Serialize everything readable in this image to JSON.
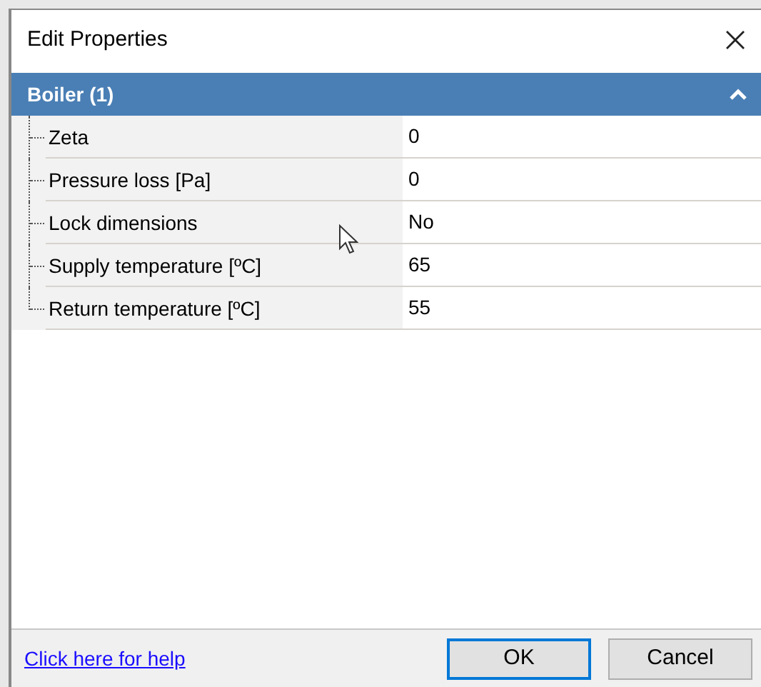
{
  "window": {
    "title": "Edit Properties"
  },
  "category": {
    "label": "Boiler (1)",
    "expanded": true
  },
  "properties": [
    {
      "name": "Zeta",
      "value": "0"
    },
    {
      "name": "Pressure loss [Pa]",
      "value": "0"
    },
    {
      "name": "Lock dimensions",
      "value": "No"
    },
    {
      "name": "Supply temperature [ºC]",
      "value": "65"
    },
    {
      "name": "Return temperature [ºC]",
      "value": "55"
    }
  ],
  "footer": {
    "help_link": "Click here for help",
    "buttons": [
      {
        "label": "OK",
        "default": true
      },
      {
        "label": "Cancel",
        "default": false
      }
    ]
  }
}
